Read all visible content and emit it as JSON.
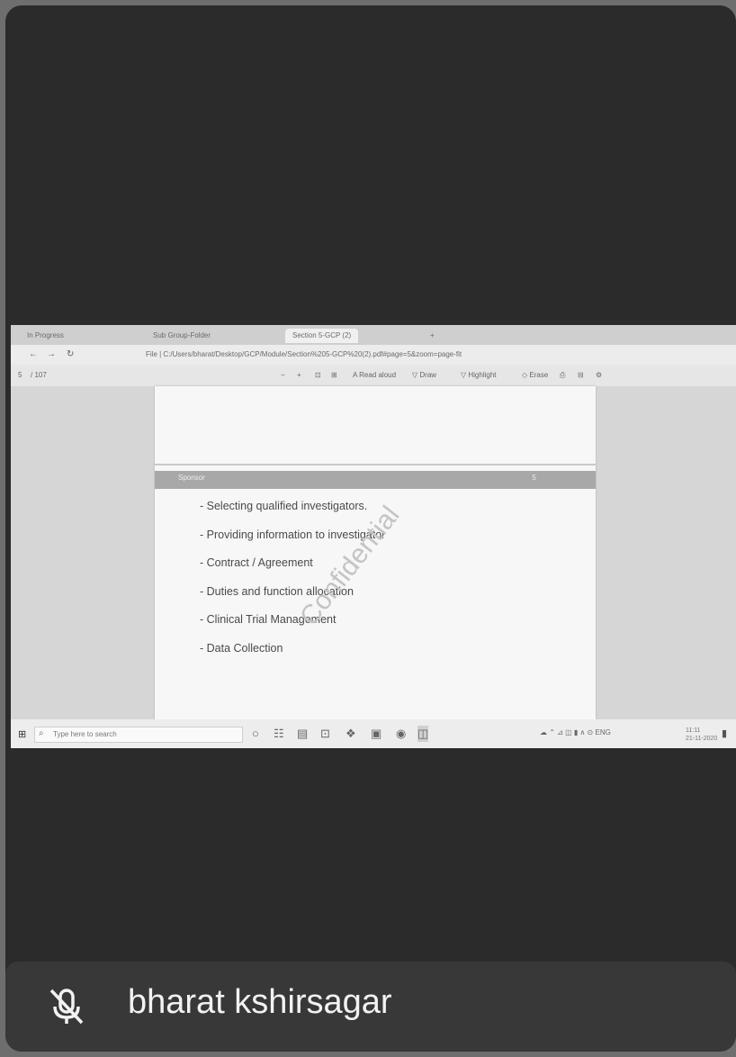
{
  "browser": {
    "tabs": [
      "In Progress",
      "Sub Group-Folder",
      "Section 5-GCP (2)",
      "+"
    ],
    "url": "File | C:/Users/bharat/Desktop/GCP/Module/Section%205-GCP%20(2).pdf#page=5&zoom=page-fit",
    "nav_glyphs": {
      "back": "←",
      "forward": "→",
      "reload": "↻"
    }
  },
  "pdf_toolbar": {
    "page": "5",
    "page_total": "/ 107",
    "tools": [
      "−",
      "+",
      "⊡",
      "⊞",
      "A Read aloud",
      "▽ Draw",
      "▽ Highlight",
      "◇ Erase",
      "⎙",
      "⊟",
      "⚙"
    ]
  },
  "slide": {
    "header_label": "Sponsor",
    "header_number": "5",
    "bullets": [
      "- Selecting qualified investigators.",
      "- Providing information to investigator",
      "- Contract / Agreement",
      "- Duties and function allocation",
      "- Clinical Trial Management",
      "- Data Collection"
    ],
    "watermark": "Confidential"
  },
  "taskbar": {
    "search_placeholder": "Type here to search",
    "tray": "☁ ⌃ ⊿ ◫ ▮ ∧ ⊙ ENG",
    "time": "11:11",
    "date": "21-11-2020"
  },
  "participant": {
    "name": "bharat kshirsagar",
    "mic_muted": true
  },
  "colors": {
    "tile_bg": "#2b2b2b",
    "name_bar_bg": "#383838",
    "header_band": "#a8a8a8"
  }
}
